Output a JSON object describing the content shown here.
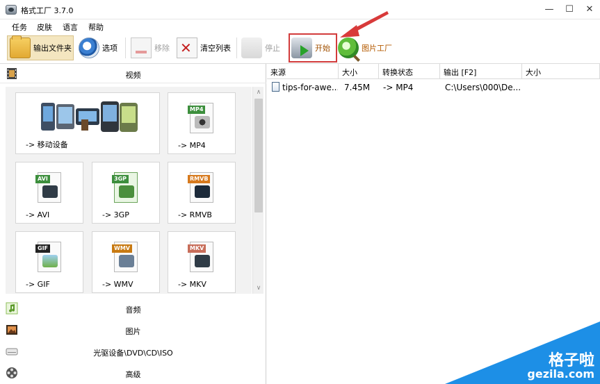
{
  "window": {
    "title": "格式工厂 3.7.0",
    "controls": {
      "minimize": "—",
      "maximize": "☐",
      "close": "✕"
    }
  },
  "menu": [
    "任务",
    "皮肤",
    "语言",
    "帮助"
  ],
  "toolbar": {
    "output_folder": "输出文件夹",
    "options": "选项",
    "remove": "移除",
    "clear_list": "清空列表",
    "stop": "停止",
    "start": "开始",
    "picture_factory": "图片工厂",
    "highlight_color": "#d23b3b"
  },
  "left_panel": {
    "categories": {
      "video": "视频",
      "audio": "音频",
      "picture": "图片",
      "dvd": "光驱设备\\DVD\\CD\\ISO",
      "advanced": "高级"
    },
    "video_formats": [
      {
        "label": "-> 移动设备",
        "icon": "mobile-devices-icon"
      },
      {
        "label": "-> MP4",
        "tag": "MP4",
        "tag_color": "#3d8f3d",
        "icon": "mp4-file-icon"
      },
      {
        "label": "-> AVI",
        "tag": "AVI",
        "tag_color": "#3d8f3d",
        "icon": "avi-file-icon"
      },
      {
        "label": "-> 3GP",
        "tag": "3GP",
        "tag_color": "#3d8f3d",
        "icon": "3gp-file-icon"
      },
      {
        "label": "-> RMVB",
        "tag": "RMVB",
        "tag_color": "#d77a1e",
        "icon": "rmvb-file-icon"
      },
      {
        "label": "-> GIF",
        "tag": "GIF",
        "tag_color": "#222222",
        "icon": "gif-file-icon"
      },
      {
        "label": "-> WMV",
        "tag": "WMV",
        "tag_color": "#c87a12",
        "icon": "wmv-file-icon"
      },
      {
        "label": "-> MKV",
        "tag": "MKV",
        "tag_color": "#c86e5a",
        "icon": "mkv-file-icon"
      }
    ],
    "scroll_up": "∧",
    "scroll_down": "∨"
  },
  "task_list": {
    "columns": [
      "来源",
      "大小",
      "转换状态",
      "输出 [F2]",
      "大小"
    ],
    "rows": [
      {
        "source": "tips-for-awe...",
        "size": "7.45M",
        "status": "-> MP4",
        "output": "C:\\Users\\000\\De...",
        "output_size": ""
      }
    ]
  },
  "watermark": {
    "title": "格子啦",
    "url": "gezila.com"
  }
}
